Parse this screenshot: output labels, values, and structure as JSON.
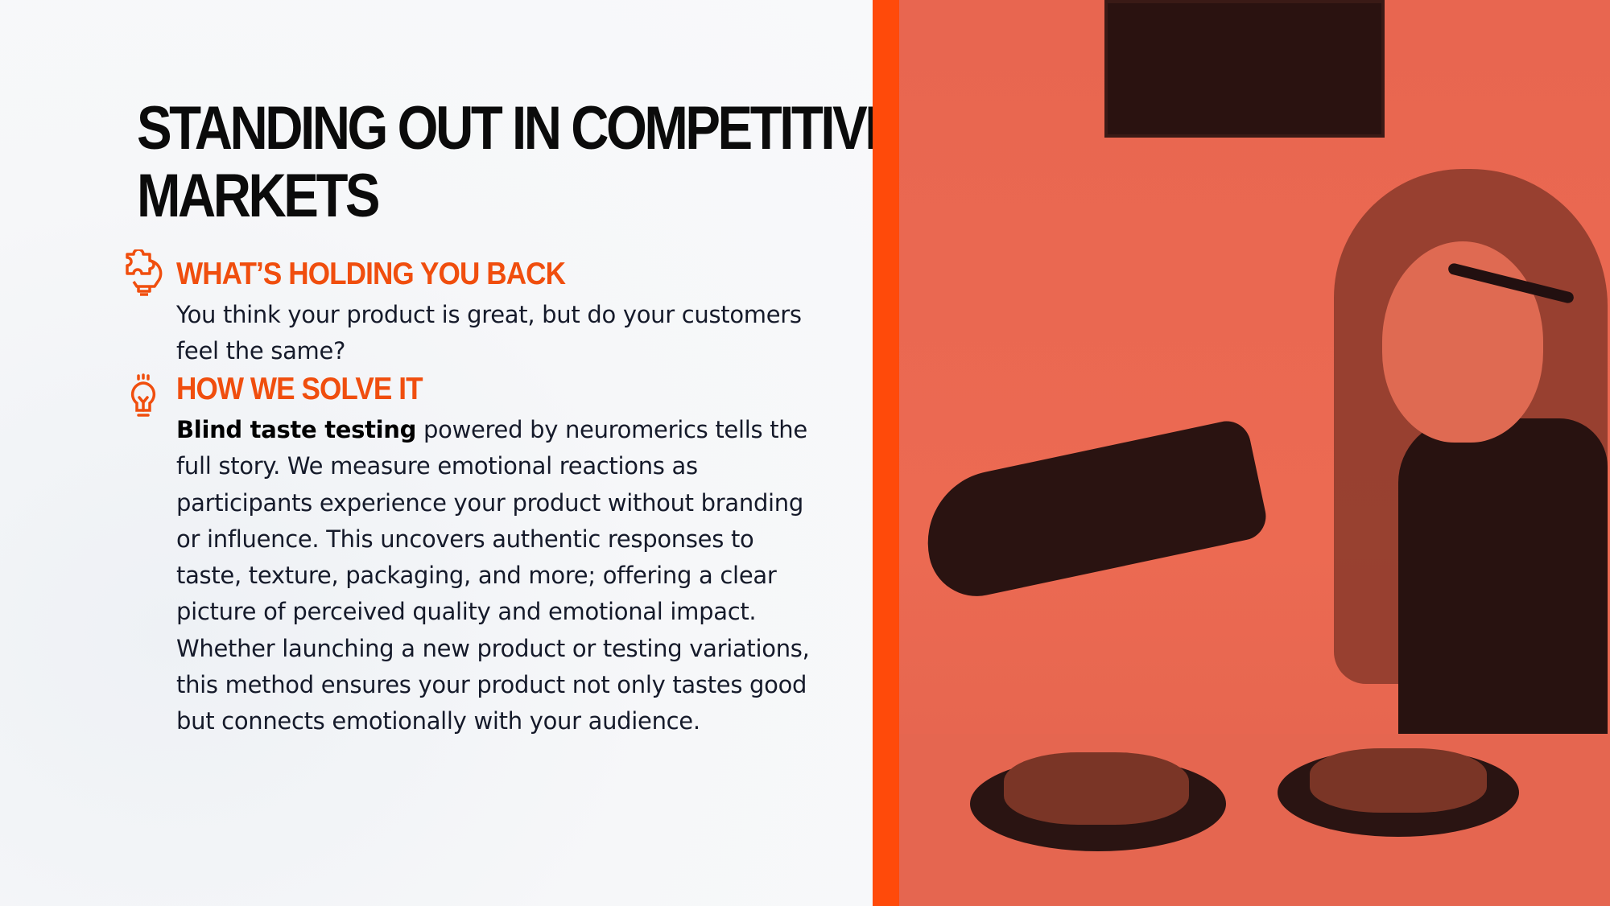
{
  "title": {
    "lines": [
      "STANDING OUT IN COMPETITIVE",
      "MARKETS"
    ]
  },
  "sections": [
    {
      "icon": "puzzle-brain-lightbulb-icon",
      "heading": "WHAT’S HOLDING YOU BACK",
      "lines": [
        "You think your product is great, but do your customers",
        "feel the same?"
      ]
    },
    {
      "icon": "lightbulb-icon",
      "heading": "HOW WE SOLVE IT",
      "bold_lead": "Blind taste testing",
      "first_line_rest": " powered by neuromerics tells the",
      "lines": [
        "full story. We measure emotional reactions as",
        "participants experience your product without branding",
        "or influence. This uncovers authentic responses to",
        "taste, texture, packaging, and more; offering a clear",
        "picture of perceived quality and emotional impact.",
        "Whether launching a new product or testing variations,",
        "this method ensures your product not only tastes good",
        "but connects emotionally with your audience."
      ]
    }
  ],
  "colors": {
    "accent": "#ff4a0a",
    "heading": "#f04e0e",
    "photo_tint": "#e86650"
  }
}
